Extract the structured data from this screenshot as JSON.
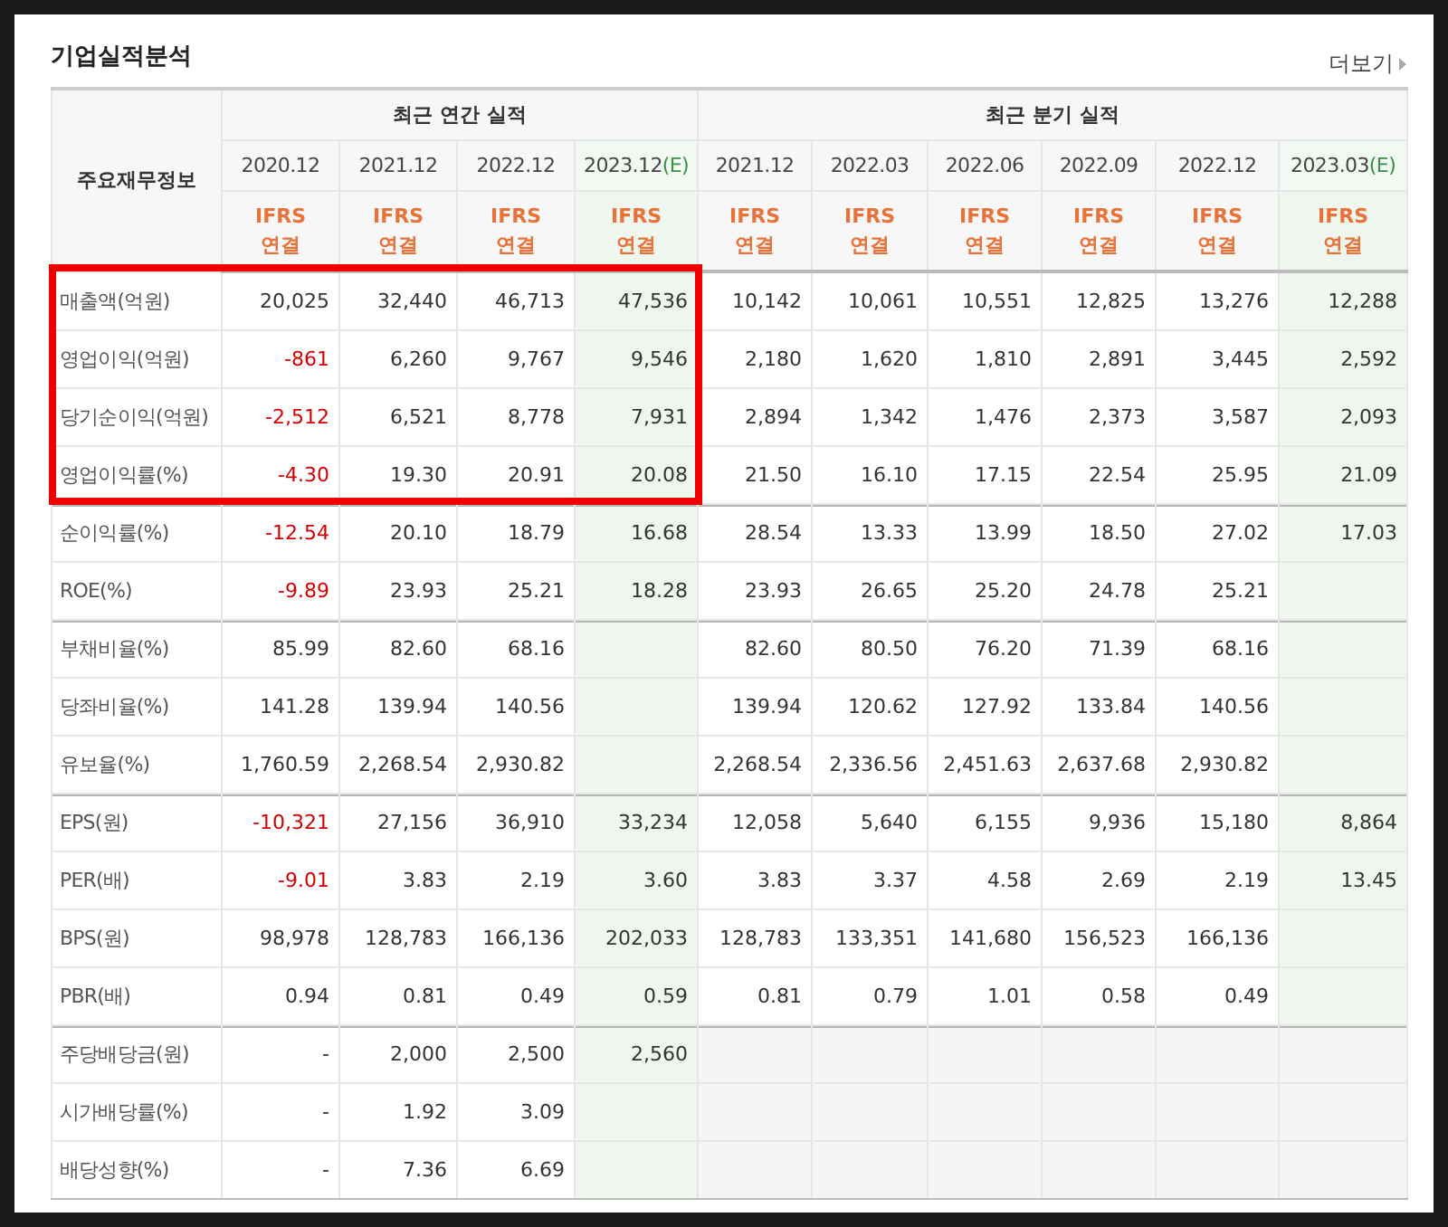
{
  "title": "기업실적분석",
  "more_link": "더보기",
  "row_header": "주요재무정보",
  "groups": [
    {
      "title": "최근 연간 실적",
      "highlighted": true,
      "columns": [
        {
          "period": "2020.12",
          "estimate": false,
          "standard": "IFRS",
          "basis": "연결"
        },
        {
          "period": "2021.12",
          "estimate": false,
          "standard": "IFRS",
          "basis": "연결"
        },
        {
          "period": "2022.12",
          "estimate": false,
          "standard": "IFRS",
          "basis": "연결"
        },
        {
          "period": "2023.12",
          "estimate": true,
          "mark": "(E)",
          "standard": "IFRS",
          "basis": "연결"
        }
      ]
    },
    {
      "title": "최근 분기 실적",
      "highlighted": false,
      "columns": [
        {
          "period": "2021.12",
          "estimate": false,
          "standard": "IFRS",
          "basis": "연결"
        },
        {
          "period": "2022.03",
          "estimate": false,
          "standard": "IFRS",
          "basis": "연결"
        },
        {
          "period": "2022.06",
          "estimate": false,
          "standard": "IFRS",
          "basis": "연결"
        },
        {
          "period": "2022.09",
          "estimate": false,
          "standard": "IFRS",
          "basis": "연결"
        },
        {
          "period": "2022.12",
          "estimate": false,
          "standard": "IFRS",
          "basis": "연결"
        },
        {
          "period": "2023.03",
          "estimate": true,
          "mark": "(E)",
          "standard": "IFRS",
          "basis": "연결"
        }
      ]
    }
  ],
  "rows": [
    {
      "label": "매출액(억원)",
      "highlighted": true,
      "section_start": false,
      "annual": [
        "20,025",
        "32,440",
        "46,713",
        "47,536"
      ],
      "quarterly": [
        "10,142",
        "10,061",
        "10,551",
        "12,825",
        "13,276",
        "12,288"
      ]
    },
    {
      "label": "영업이익(억원)",
      "highlighted": true,
      "section_start": false,
      "annual": [
        "-861",
        "6,260",
        "9,767",
        "9,546"
      ],
      "quarterly": [
        "2,180",
        "1,620",
        "1,810",
        "2,891",
        "3,445",
        "2,592"
      ]
    },
    {
      "label": "당기순이익(억원)",
      "highlighted": true,
      "section_start": false,
      "annual": [
        "-2,512",
        "6,521",
        "8,778",
        "7,931"
      ],
      "quarterly": [
        "2,894",
        "1,342",
        "1,476",
        "2,373",
        "3,587",
        "2,093"
      ]
    },
    {
      "label": "영업이익률(%)",
      "highlighted": true,
      "section_start": false,
      "annual": [
        "-4.30",
        "19.30",
        "20.91",
        "20.08"
      ],
      "quarterly": [
        "21.50",
        "16.10",
        "17.15",
        "22.54",
        "25.95",
        "21.09"
      ]
    },
    {
      "label": "순이익률(%)",
      "highlighted": false,
      "section_start": true,
      "annual": [
        "-12.54",
        "20.10",
        "18.79",
        "16.68"
      ],
      "quarterly": [
        "28.54",
        "13.33",
        "13.99",
        "18.50",
        "27.02",
        "17.03"
      ]
    },
    {
      "label": "ROE(%)",
      "highlighted": false,
      "section_start": false,
      "annual": [
        "-9.89",
        "23.93",
        "25.21",
        "18.28"
      ],
      "quarterly": [
        "23.93",
        "26.65",
        "25.20",
        "24.78",
        "25.21"
      ]
    },
    {
      "label": "부채비율(%)",
      "highlighted": false,
      "section_start": true,
      "annual": [
        "85.99",
        "82.60",
        "68.16"
      ],
      "quarterly": [
        "82.60",
        "80.50",
        "76.20",
        "71.39",
        "68.16"
      ]
    },
    {
      "label": "당좌비율(%)",
      "highlighted": false,
      "section_start": false,
      "annual": [
        "141.28",
        "139.94",
        "140.56"
      ],
      "quarterly": [
        "139.94",
        "120.62",
        "127.92",
        "133.84",
        "140.56"
      ]
    },
    {
      "label": "유보율(%)",
      "highlighted": false,
      "section_start": false,
      "annual": [
        "1,760.59",
        "2,268.54",
        "2,930.82"
      ],
      "quarterly": [
        "2,268.54",
        "2,336.56",
        "2,451.63",
        "2,637.68",
        "2,930.82"
      ]
    },
    {
      "label": "EPS(원)",
      "highlighted": false,
      "section_start": true,
      "annual": [
        "-10,321",
        "27,156",
        "36,910",
        "33,234"
      ],
      "quarterly": [
        "12,058",
        "5,640",
        "6,155",
        "9,936",
        "15,180",
        "8,864"
      ]
    },
    {
      "label": "PER(배)",
      "highlighted": false,
      "section_start": false,
      "annual": [
        "-9.01",
        "3.83",
        "2.19",
        "3.60"
      ],
      "quarterly": [
        "3.83",
        "3.37",
        "4.58",
        "2.69",
        "2.19",
        "13.45"
      ]
    },
    {
      "label": "BPS(원)",
      "highlighted": false,
      "section_start": false,
      "annual": [
        "98,978",
        "128,783",
        "166,136",
        "202,033"
      ],
      "quarterly": [
        "128,783",
        "133,351",
        "141,680",
        "156,523",
        "166,136"
      ]
    },
    {
      "label": "PBR(배)",
      "highlighted": false,
      "section_start": false,
      "annual": [
        "0.94",
        "0.81",
        "0.49",
        "0.59"
      ],
      "quarterly": [
        "0.81",
        "0.79",
        "1.01",
        "0.58",
        "0.49"
      ]
    },
    {
      "label": "주당배당금(원)",
      "highlighted": false,
      "section_start": true,
      "annual": [
        "-",
        "2,000",
        "2,500",
        "2,560"
      ]
    },
    {
      "label": "시가배당률(%)",
      "highlighted": false,
      "section_start": false,
      "annual": [
        "-",
        "1.92",
        "3.09"
      ]
    },
    {
      "label": "배당성향(%)",
      "highlighted": false,
      "section_start": false,
      "annual": [
        "-",
        "7.36",
        "6.69"
      ]
    }
  ]
}
